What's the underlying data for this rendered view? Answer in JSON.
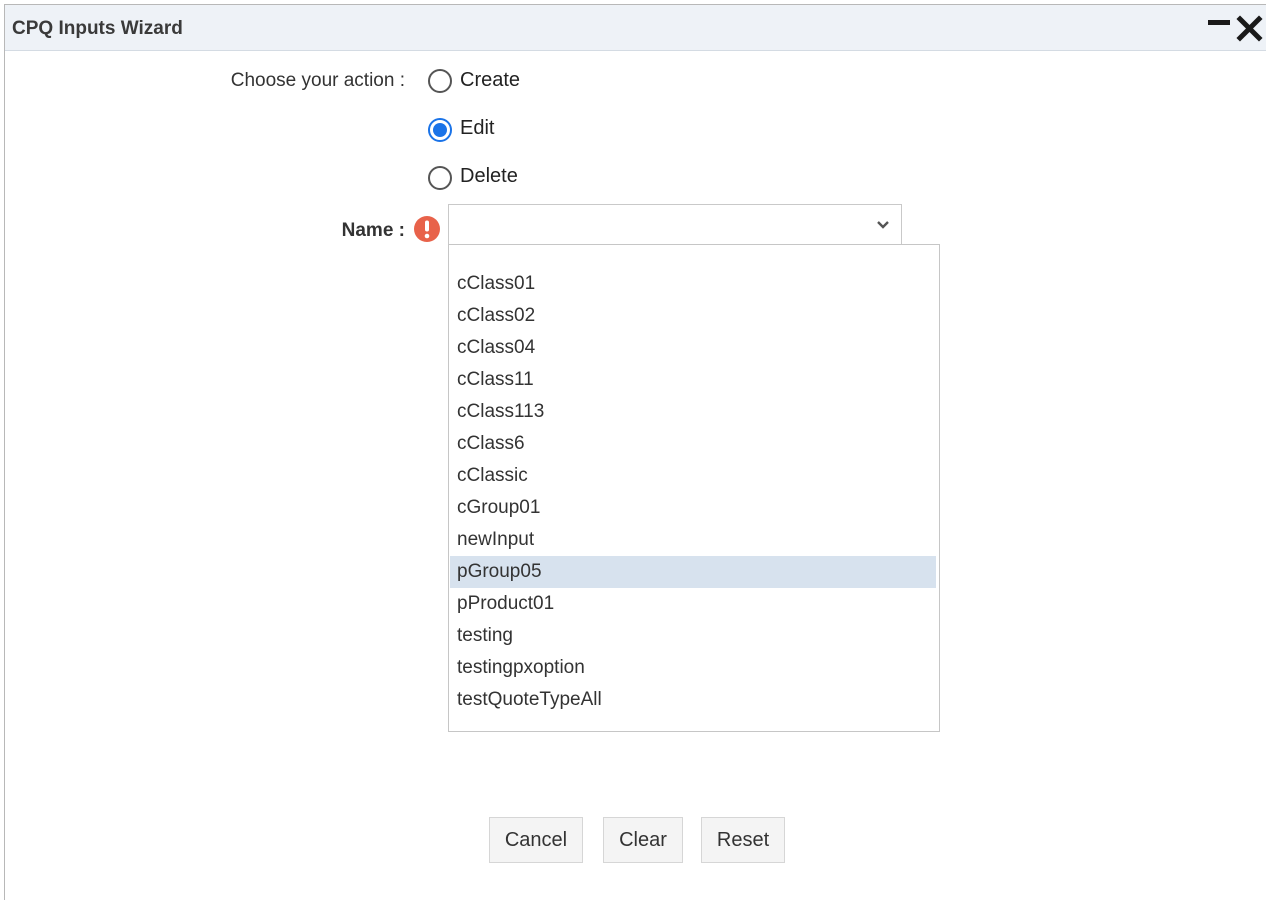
{
  "window": {
    "title": "CPQ Inputs Wizard",
    "controls": {
      "minimize_icon": "minimize-icon",
      "close_icon": "close-icon"
    }
  },
  "form": {
    "action": {
      "label": "Choose your action :",
      "selected": "Edit",
      "options": [
        {
          "label": "Create",
          "checked": false
        },
        {
          "label": "Edit",
          "checked": true
        },
        {
          "label": "Delete",
          "checked": false
        }
      ]
    },
    "name": {
      "label": "Name :",
      "required_icon": "error-exclamation-icon",
      "value": "",
      "dropdown_open": true,
      "highlighted": "pGroup05",
      "options": [
        "",
        "cClass01",
        "cClass02",
        "cClass04",
        "cClass11",
        "cClass113",
        "cClass6",
        "cClassic",
        "cGroup01",
        "newInput",
        "pGroup05",
        "pProduct01",
        "testing",
        "testingpxoption",
        "testQuoteTypeAll"
      ]
    }
  },
  "buttons": {
    "cancel": "Cancel",
    "clear": "Clear",
    "reset": "Reset"
  },
  "colors": {
    "title_bar": "#eef2f7",
    "radio_accent": "#1a73e8",
    "required_icon": "#e8624a",
    "highlight_row": "#d7e2ee"
  }
}
